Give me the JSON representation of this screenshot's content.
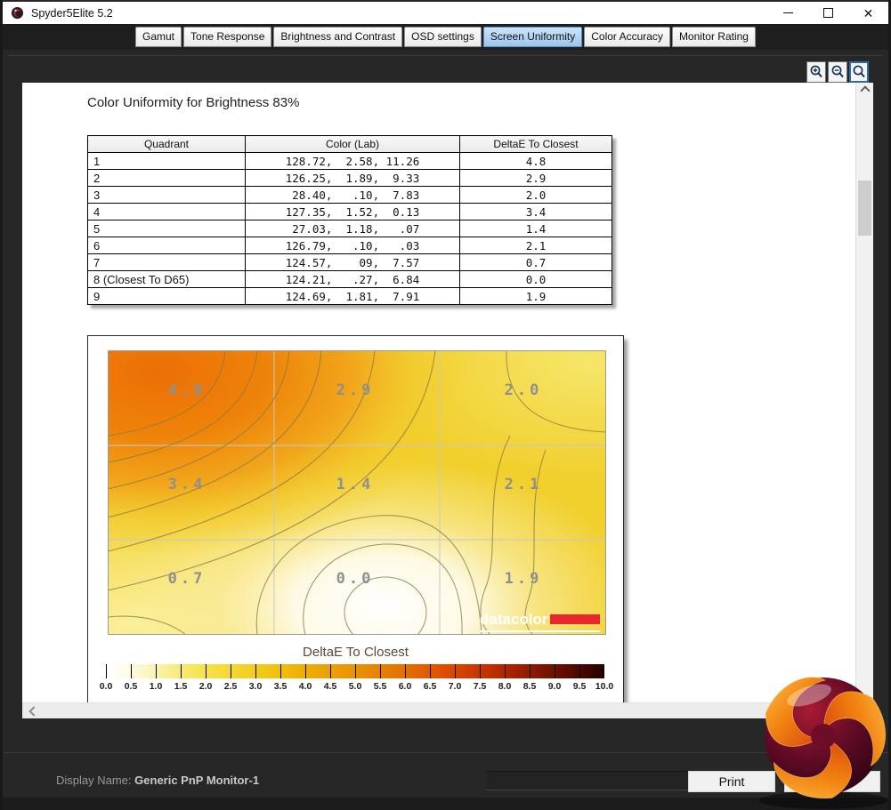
{
  "window": {
    "title": "Spyder5Elite 5.2",
    "controls": {
      "minimize": "minimize",
      "maximize": "maximize",
      "close": "close"
    }
  },
  "tabs": [
    {
      "label": "Gamut",
      "active": false
    },
    {
      "label": "Tone Response",
      "active": false
    },
    {
      "label": "Brightness and Contrast",
      "active": false
    },
    {
      "label": "OSD settings",
      "active": false
    },
    {
      "label": "Screen Uniformity",
      "active": true
    },
    {
      "label": "Color Accuracy",
      "active": false
    },
    {
      "label": "Monitor Rating",
      "active": false
    }
  ],
  "toolbar": {
    "zoom_in_icon": "magnifier-plus",
    "zoom_out_icon": "magnifier-minus",
    "zoom_reset_icon": "magnifier"
  },
  "page": {
    "heading": "Color Uniformity for Brightness 83%",
    "table": {
      "columns": [
        "Quadrant",
        "Color (Lab)",
        "DeltaE To Closest"
      ],
      "rows": [
        {
          "quadrant": "1",
          "lab": "128.72,  2.58, 11.26",
          "delta": "4.8"
        },
        {
          "quadrant": "2",
          "lab": "126.25,  1.89,  9.33",
          "delta": "2.9"
        },
        {
          "quadrant": "3",
          "lab": " 28.40,   .10,  7.83",
          "delta": "2.0"
        },
        {
          "quadrant": "4",
          "lab": "127.35,  1.52,  0.13",
          "delta": "3.4"
        },
        {
          "quadrant": "5",
          "lab": " 27.03,  1.18,   .07",
          "delta": "1.4"
        },
        {
          "quadrant": "6",
          "lab": "126.79,   .10,   .03",
          "delta": "2.1"
        },
        {
          "quadrant": "7",
          "lab": "124.57,    09,  7.57",
          "delta": "0.7"
        },
        {
          "quadrant": "8 (Closest To D65)",
          "lab": "124.21,   .27,  6.84",
          "delta": "0.0"
        },
        {
          "quadrant": "9",
          "lab": "124.69,  1.81,  7.91",
          "delta": "1.9"
        }
      ]
    }
  },
  "chart_data": {
    "type": "heatmap",
    "title": "DeltaE To Closest",
    "description": "Screen uniformity contour map, 3x3 quadrant DeltaE values, hot spot top-left, best point bottom-center",
    "grid_values": [
      [
        4.8,
        2.9,
        2.0
      ],
      [
        3.4,
        1.4,
        2.1
      ],
      [
        0.7,
        0.0,
        1.9
      ]
    ],
    "colorbar": {
      "min": 0.0,
      "max": 10.0,
      "step": 0.5,
      "tick_labels": [
        "0.0",
        "0.5",
        "1.0",
        "1.5",
        "2.0",
        "2.5",
        "3.0",
        "3.5",
        "4.0",
        "4.5",
        "5.0",
        "5.5",
        "6.0",
        "6.5",
        "7.0",
        "7.5",
        "8.0",
        "8.5",
        "9.0",
        "9.5",
        "10.0"
      ]
    },
    "watermark": "datacolor",
    "colors": {
      "low": "#ffffff",
      "mid": "#f2c716",
      "high": "#230200",
      "hotspot": "#ec6f06"
    }
  },
  "footer": {
    "display_name_label": "Display Name:",
    "display_name_value": "Generic PnP Monitor-1",
    "print_label": "Print"
  }
}
